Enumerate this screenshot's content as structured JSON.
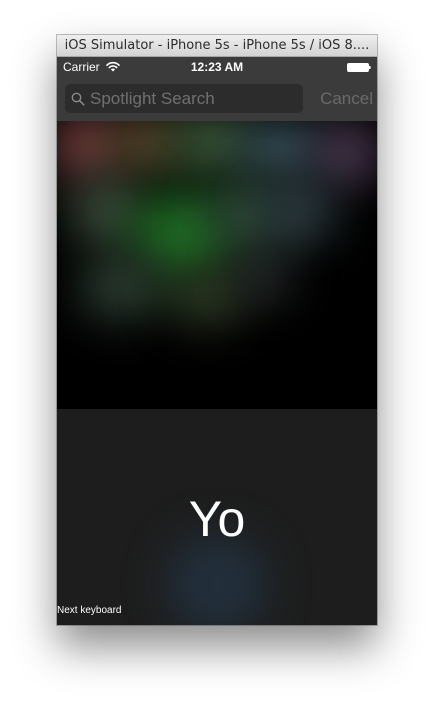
{
  "window": {
    "title": "iOS Simulator - iPhone 5s - iPhone 5s / iOS 8...."
  },
  "status_bar": {
    "carrier": "Carrier",
    "time": "12:23 AM",
    "wifi_icon": "wifi-icon",
    "battery_icon": "battery-icon"
  },
  "search": {
    "placeholder": "Spotlight Search",
    "value": "",
    "icon": "search-icon",
    "cancel_label": "Cancel"
  },
  "keyboard": {
    "text": "Yo",
    "next_keyboard_label": "Next keyboard",
    "background": "#1d1d1d"
  },
  "colors": {
    "status_bar_bg": "#3b3b3b",
    "search_field_bg": "#2c2c2c",
    "cancel_text": "#6a6a6a"
  }
}
